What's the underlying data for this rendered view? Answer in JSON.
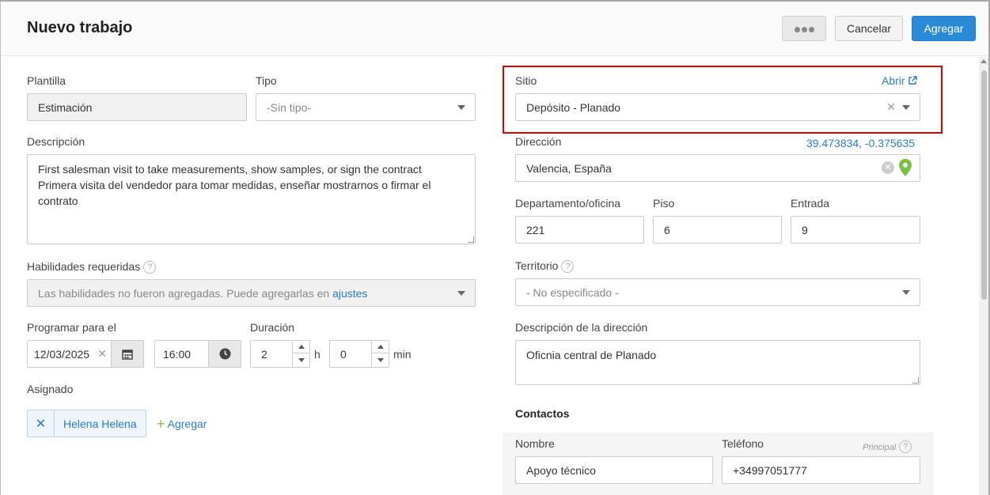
{
  "header": {
    "title": "Nuevo trabajo",
    "cancel_label": "Cancelar",
    "add_label": "Agregar"
  },
  "left": {
    "template_label": "Plantilla",
    "template_value": "Estimación",
    "type_label": "Tipo",
    "type_placeholder": "-Sin tipo-",
    "description_label": "Descripción",
    "description_value": "First salesman visit to take measurements, show samples, or sign the contract\nPrimera visita del vendedor para tomar medidas, enseñar mostrarnos o firmar el contrato",
    "skills_label": "Habilidades requeridas",
    "skills_help": "?",
    "skills_text": "Las habilidades no fueron agregadas. Puede agregarlas en",
    "skills_link": "ajustes",
    "schedule_label": "Programar para el",
    "date_value": "12/03/2025",
    "time_value": "16:00",
    "duration_label": "Duración",
    "hours_value": "2",
    "hours_unit": "h",
    "minutes_value": "0",
    "minutes_unit": "min",
    "assigned_label": "Asignado",
    "assignee": "Helena Helena",
    "add_assignee": "Agregar"
  },
  "right": {
    "site_label": "Sitio",
    "open_link": "Abrir",
    "site_value": "Depósito - Planado",
    "address_label": "Dirección",
    "coordinates": "39.473834, -0.375635",
    "address_value": "Valencia, España",
    "department_label": "Departamento/oficina",
    "department_value": "221",
    "floor_label": "Piso",
    "floor_value": "6",
    "entrance_label": "Entrada",
    "entrance_value": "9",
    "territory_label": "Territorio",
    "territory_help": "?",
    "territory_value": "- No especificado -",
    "address_desc_label": "Descripción de la dirección",
    "address_desc_value": "Oficnia central de Planado",
    "contacts_title": "Contactos",
    "contact_name_label": "Nombre",
    "contact_phone_label": "Teléfono",
    "principal_label": "Principal",
    "principal_help": "?",
    "contact_name_value": "Apoyo técnico",
    "contact_phone_value": "+34997051777"
  },
  "colors": {
    "accent": "#2b8ad6",
    "highlight": "#e00000",
    "pin": "#7ac143"
  },
  "icons": {
    "more": "more-dots-icon",
    "calendar": "calendar-icon",
    "clock": "clock-icon",
    "external": "external-link-icon",
    "pin": "map-pin-icon"
  }
}
